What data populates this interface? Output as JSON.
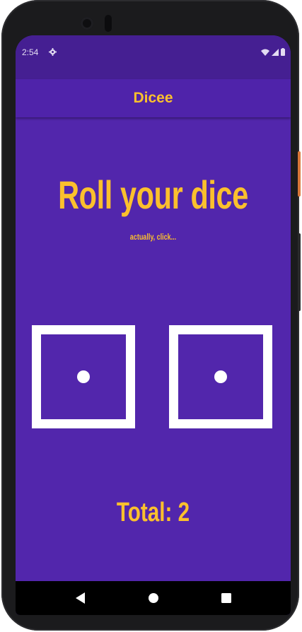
{
  "status_bar": {
    "time": "2:54",
    "icons": [
      "settings-icon",
      "wifi-icon",
      "signal-icon",
      "battery-icon"
    ]
  },
  "app_bar": {
    "title": "Dicee"
  },
  "main": {
    "heading": "Roll your dice",
    "subheading": "actually, click...",
    "dice": [
      {
        "label": "left-die",
        "value": 1
      },
      {
        "label": "right-die",
        "value": 1
      }
    ],
    "total_text": "Total: 2"
  },
  "nav_bar": {
    "buttons": [
      "back-icon",
      "home-icon",
      "recents-icon"
    ]
  },
  "colors": {
    "background": "#5226ac",
    "status_bar": "#451f92",
    "app_bar": "#4f23aa",
    "accent": "#fbc02d",
    "dice": "#ffffff",
    "nav_bar": "#000000"
  }
}
